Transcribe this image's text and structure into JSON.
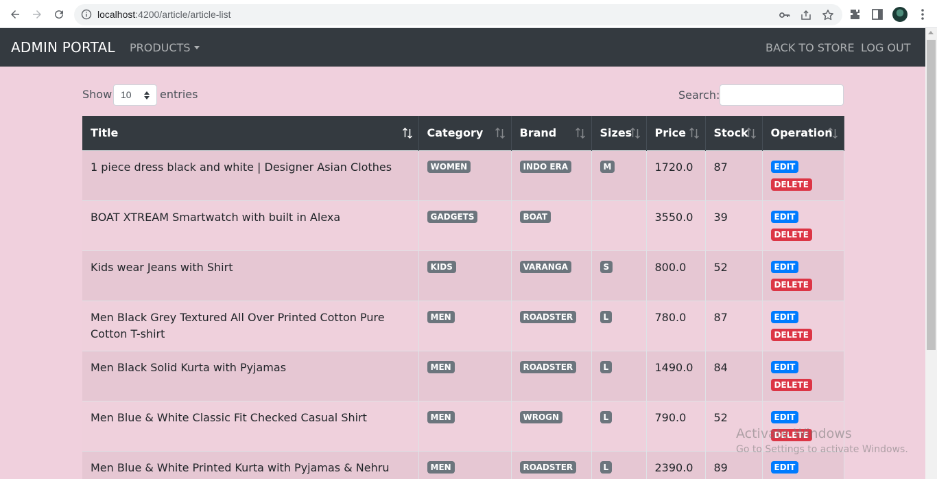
{
  "browser": {
    "url_host": "localhost",
    "url_rest": ":4200/article/article-list"
  },
  "navbar": {
    "brand": "ADMIN PORTAL",
    "products_label": "PRODUCTS",
    "back_to_store": "BACK TO STORE",
    "log_out": "LOG OUT"
  },
  "controls": {
    "show_label": "Show",
    "entries_value": "10",
    "entries_label": "entries",
    "search_label": "Search:",
    "search_value": ""
  },
  "table": {
    "columns": [
      "Title",
      "Category",
      "Brand",
      "Sizes",
      "Price",
      "Stock",
      "Operation"
    ],
    "edit_label": "EDIT",
    "delete_label": "DELETE",
    "rows": [
      {
        "title": "1 piece dress black and white | Designer Asian Clothes",
        "category": "WOMEN",
        "brand": "INDO ERA",
        "size": "M",
        "price": "1720.0",
        "stock": "87"
      },
      {
        "title": "BOAT XTREAM Smartwatch with built in Alexa",
        "category": "GADGETS",
        "brand": "BOAT",
        "size": "",
        "price": "3550.0",
        "stock": "39"
      },
      {
        "title": "Kids wear Jeans with Shirt",
        "category": "KIDS",
        "brand": "VARANGA",
        "size": "S",
        "price": "800.0",
        "stock": "52"
      },
      {
        "title": "Men Black Grey Textured All Over Printed Cotton Pure Cotton T-shirt",
        "category": "MEN",
        "brand": "ROADSTER",
        "size": "L",
        "price": "780.0",
        "stock": "87"
      },
      {
        "title": "Men Black Solid Kurta with Pyjamas",
        "category": "MEN",
        "brand": "ROADSTER",
        "size": "L",
        "price": "1490.0",
        "stock": "84"
      },
      {
        "title": "Men Blue & White Classic Fit Checked Casual Shirt",
        "category": "MEN",
        "brand": "WROGN",
        "size": "L",
        "price": "790.0",
        "stock": "52"
      },
      {
        "title": "Men Blue & White Printed Kurta with Pyjamas & Nehru Jacket",
        "category": "MEN",
        "brand": "ROADSTER",
        "size": "L",
        "price": "2390.0",
        "stock": "89"
      }
    ]
  },
  "watermark": {
    "title": "Activate Windows",
    "subtitle": "Go to Settings to activate Windows."
  }
}
